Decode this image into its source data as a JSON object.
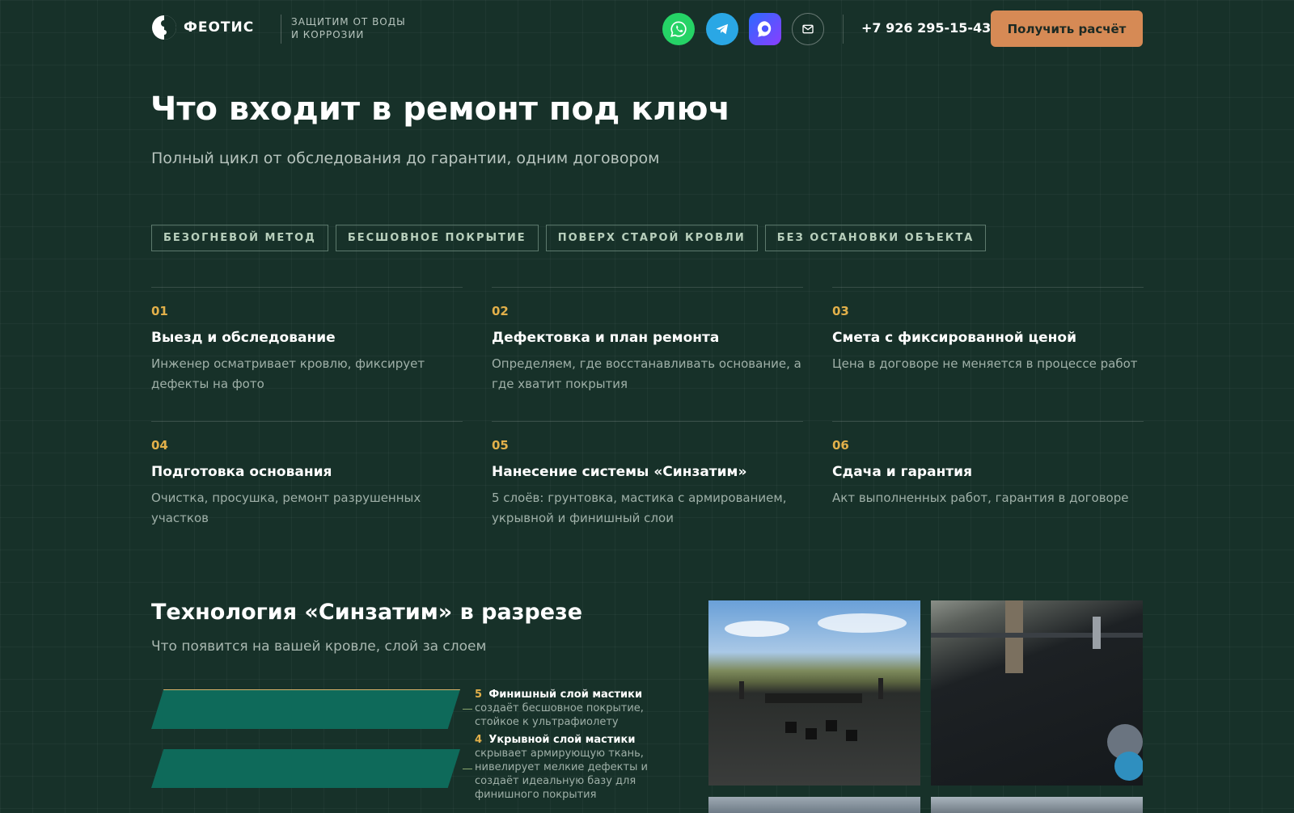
{
  "header": {
    "logo_text": "ФЕОТИС",
    "tagline_line1": "ЗАЩИТИМ ОТ ВОДЫ",
    "tagline_line2": "И КОРРОЗИИ",
    "phone": "+7 926 295-15-43",
    "cta_label": "Получить расчёт",
    "social": [
      {
        "name": "whatsapp-icon",
        "color": "#25d366"
      },
      {
        "name": "telegram-icon",
        "color": "#2aa7e5"
      },
      {
        "name": "max-messenger-icon",
        "color": "#6a4bff"
      },
      {
        "name": "mail-icon",
        "color": "#ffffff"
      }
    ]
  },
  "hero": {
    "title": "Что входит в ремонт под ключ",
    "subtitle": "Полный цикл от обследования до гарантии, одним договором",
    "tags": [
      "БЕЗОГНЕВОЙ МЕТОД",
      "БЕСШОВНОЕ ПОКРЫТИЕ",
      "ПОВЕРХ СТАРОЙ КРОВЛИ",
      "БЕЗ ОСТАНОВКИ ОБЪЕКТА"
    ]
  },
  "steps": [
    {
      "num": "01",
      "title": "Выезд и обследование",
      "desc": "Инженер осматривает кровлю, фиксирует дефекты на фото"
    },
    {
      "num": "02",
      "title": "Дефектовка и план ремонта",
      "desc": "Определяем, где восстанавливать основание, а где хватит покрытия"
    },
    {
      "num": "03",
      "title": "Смета с фиксированной ценой",
      "desc": "Цена в договоре не меняется в процессе работ"
    },
    {
      "num": "04",
      "title": "Подготовка основания",
      "desc": "Очистка, просушка, ремонт разрушенных участков"
    },
    {
      "num": "05",
      "title": "Нанесение системы «Синзатим»",
      "desc": "5 слоёв: грунтовка, мастика с армированием, укрывной и финишный слои"
    },
    {
      "num": "06",
      "title": "Сдача и гарантия",
      "desc": "Акт выполненных работ, гарантия в договоре"
    }
  ],
  "tech": {
    "title": "Технология «Синзатим» в разрезе",
    "subtitle": "Что появится на вашей кровле, слой за слоем",
    "layers": [
      {
        "num": "5",
        "title": "Финишный слой мастики",
        "desc": "создаёт бесшовное покрытие, стойкое к ультрафиолету"
      },
      {
        "num": "4",
        "title": "Укрывной слой мастики",
        "desc": "скрывает армирующую ткань, нивелирует мелкие дефекты и создаёт идеальную базу для финишного покрытия"
      }
    ]
  },
  "colors": {
    "background": "#173129",
    "accent_orange": "#d68a55",
    "accent_gold": "#e2b04a",
    "layer_green": "#0e6a5a"
  }
}
